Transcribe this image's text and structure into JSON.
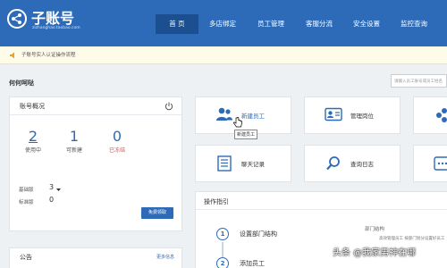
{
  "header": {
    "brand": "子账号",
    "brand_sub": "zizhanghao.taobao.com",
    "nav": [
      {
        "label": "首 页",
        "active": true
      },
      {
        "label": "多店绑定",
        "active": false
      },
      {
        "label": "员工管理",
        "active": false
      },
      {
        "label": "客服分流",
        "active": false
      },
      {
        "label": "安全设置",
        "active": false
      },
      {
        "label": "监控查询",
        "active": false
      }
    ]
  },
  "notice": {
    "text": "子账号实人认证操作流程"
  },
  "company": {
    "name": "何何呵哒"
  },
  "search": {
    "placeholder": "请输入员工账号或员工姓名"
  },
  "account": {
    "title": "账号概况",
    "stats": [
      {
        "value": "2",
        "label": "使用中"
      },
      {
        "value": "1",
        "label": "可新建"
      },
      {
        "value": "0",
        "label": "已冻结"
      }
    ],
    "basic_label": "基础版",
    "basic_value": "3",
    "standard_label": "标准版",
    "standard_value": "0",
    "free_button": "免费领取"
  },
  "cards": [
    {
      "label": "新建员工",
      "icon": "users-icon"
    },
    {
      "label": "管理岗位",
      "icon": "id-card-icon"
    },
    {
      "label": "聊天记录",
      "icon": "document-icon"
    },
    {
      "label": "查询日志",
      "icon": "search-icon"
    }
  ],
  "tooltip": "新建员工",
  "guide": {
    "title": "操作指引",
    "steps": [
      {
        "num": "1",
        "label": "设置部门结构"
      },
      {
        "num": "2",
        "label": "添加员工"
      }
    ],
    "dept_label": "部门结构",
    "dept_text": "高效管理员工 按部门划分设置好员工"
  },
  "announce": {
    "title": "公告",
    "more": "更多信息"
  },
  "watermark": "头条 @我家男神在哪",
  "colors": {
    "primary": "#2d6bb8",
    "nav_active": "#1b4f8f",
    "frozen": "#d9534f"
  }
}
